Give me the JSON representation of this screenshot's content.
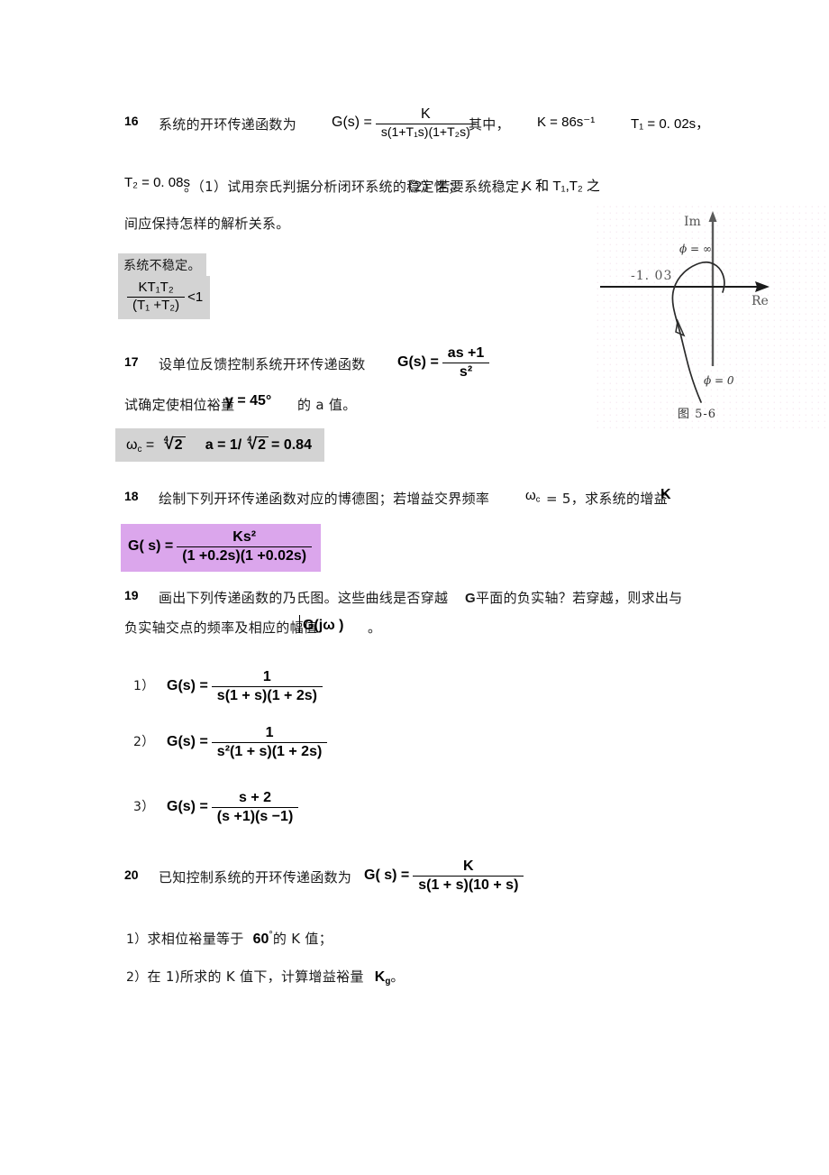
{
  "document": {
    "type": "control-systems-exercise-sheet",
    "language": "zh-CN"
  },
  "problem16": {
    "number": "16",
    "intro": "系统的开环传递函数为",
    "formula": {
      "lhs": "G(s) =",
      "numerator": "K",
      "denominator": "s(1+T₁s)(1+T₂s)"
    },
    "qizhong": "其中，",
    "k_value": "K = 86s⁻¹",
    "t1_value": "T₁ = 0. 02s，",
    "t2_value": "T₂ = 0. 08s",
    "part1": "。（1）试用奈氏判据分析闭环系统的稳定性；",
    "part2": "（2）若要系统稳定，",
    "part2_tail": "K 和 T₁,T₂ 之",
    "line3": "间应保持怎样的解析关系。",
    "answer_text": "系统不稳定。",
    "answer_formula": {
      "numerator": "KT₁T₂",
      "denominator": "(T₁ +T₂)",
      "relation": "<1"
    }
  },
  "problem17": {
    "number": "17",
    "intro": "设单位反馈控制系统开环传递函数",
    "formula": {
      "lhs": "G(s) =",
      "numerator": "as +1",
      "denominator": "s²"
    },
    "line2_a": "试确定使相位裕量",
    "line2_b": "γ = 45°",
    "line2_c": "的 a 值。",
    "answer": {
      "omega_label": "ω",
      "omega_sub": "c",
      "omega_eq": "=",
      "omega_root_index": "4",
      "omega_radicand": "2",
      "a_lhs": "a = 1/",
      "a_root_index": "4",
      "a_radicand": "2",
      "a_result": "= 0.84"
    }
  },
  "problem18": {
    "number": "18",
    "intro": "绘制下列开环传递函数对应的博德图；若增益交界频率",
    "omega_c": "ω",
    "omega_c_sub": "c",
    "omega_c_value": "= 5，求系统的增益",
    "k_tail": "K",
    "formula": {
      "lhs": "G( s) =",
      "numerator": "Ks²",
      "denominator": "(1 +0.2s)(1 +0.02s)"
    }
  },
  "problem19": {
    "number": "19",
    "line1_a": "画出下列传递函数的乃氏图。这些曲线是否穿越",
    "line1_b": "G 平面的负实轴？若穿越，则求出与",
    "line2_a": "负实轴交点的频率及相应的幅值",
    "line2_b": "G(jω )",
    "line2_c": "。",
    "items": [
      {
        "label": "1）",
        "lhs": "G(s) =",
        "numerator": "1",
        "denominator": "s(1 + s)(1 + 2s)"
      },
      {
        "label": "2）",
        "lhs": "G(s) =",
        "numerator": "1",
        "denominator": "s²(1 + s)(1 + 2s)"
      },
      {
        "label": "3）",
        "lhs": "G(s) =",
        "numerator": "s + 2",
        "denominator": "(s +1)(s −1)"
      }
    ]
  },
  "problem20": {
    "number": "20",
    "intro": "已知控制系统的开环传递函数为",
    "formula": {
      "lhs": "G( s) =",
      "numerator": "K",
      "denominator": "s(1 + s)(10 + s)"
    },
    "items": [
      {
        "label": "1）",
        "text_a": "求相位裕量等于",
        "value": "60",
        "degree": "°",
        "text_b": "的 K 值；"
      },
      {
        "label": "2）",
        "text_a": "在 1)所求的 K 值下，计算增益裕量",
        "value": "K",
        "sub": "g",
        "text_b": "。"
      }
    ]
  },
  "figure": {
    "caption": "图 5-6",
    "axis_imag": "Im",
    "axis_real": "Re",
    "crossing_label": "-1. 03",
    "omega_inf": "ϖ = ∞",
    "omega_zero": "ϖ = 0"
  },
  "colors": {
    "highlight_grey": "#d3d3d3",
    "highlight_purple": "#dba6ec",
    "text": "#1a1a1a",
    "plus_tint": "#2f6f4f"
  }
}
